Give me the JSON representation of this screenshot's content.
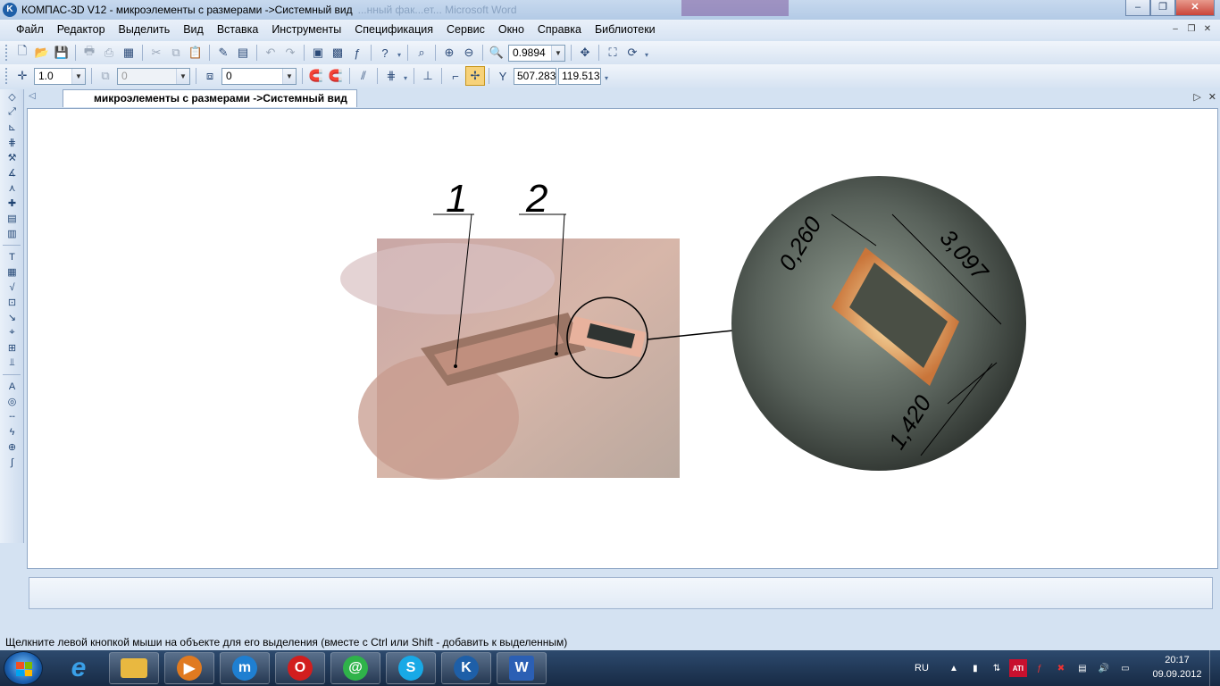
{
  "window": {
    "title": "КОМПАС-3D V12 - микроэлементы с размерами ->Системный вид",
    "ghost_text": "...нный фак...ет... Microsoft Word",
    "minimize_glyph": "–",
    "maximize_glyph": "❐",
    "close_glyph": "✕"
  },
  "menu": {
    "items": [
      "Файл",
      "Редактор",
      "Выделить",
      "Вид",
      "Вставка",
      "Инструменты",
      "Спецификация",
      "Сервис",
      "Окно",
      "Справка",
      "Библиотеки"
    ],
    "mdi_minimize": "–",
    "mdi_restore": "❐",
    "mdi_close": "✕"
  },
  "toolbar_view": {
    "zoom_value": "0.9894"
  },
  "toolbar_current": {
    "step_value": "1.0",
    "layer_value": "0",
    "style_value": "0",
    "x_label": "Y",
    "x_coord": "507.283",
    "y_coord": "119.513"
  },
  "document_tab": {
    "title": "микроэлементы с размерами ->Системный вид"
  },
  "drawing": {
    "callout_1": "1",
    "callout_2": "2",
    "dim_wall": "0,260",
    "dim_width": "3,097",
    "dim_height": "1,420"
  },
  "status": {
    "message": "Щелкните левой кнопкой мыши на объекте для его выделения (вместе с Ctrl или Shift - добавить к выделенным)"
  },
  "taskbar": {
    "apps": [
      {
        "name": "taskbar-explorer",
        "glyph": "",
        "color": "#e9b840"
      },
      {
        "name": "taskbar-media-player",
        "glyph": "▶",
        "color": "#e07a20"
      },
      {
        "name": "taskbar-maxthon",
        "glyph": "m",
        "color": "#1f7fd1"
      },
      {
        "name": "taskbar-opera",
        "glyph": "O",
        "color": "#d21e1e"
      },
      {
        "name": "taskbar-mail-agent",
        "glyph": "@",
        "color": "#2fb34a"
      },
      {
        "name": "taskbar-skype",
        "glyph": "S",
        "color": "#18a9e6"
      },
      {
        "name": "taskbar-kompas",
        "glyph": "K",
        "color": "#1e5fa8"
      },
      {
        "name": "taskbar-word",
        "glyph": "W",
        "color": "#2b5fb4"
      }
    ],
    "ie_glyph": "e",
    "language": "RU",
    "tray_ati": "ATI",
    "time": "20:17",
    "date": "09.09.2012"
  },
  "colors": {
    "accent": "#1e5fa8",
    "taskbar": "#1f3858",
    "callout_line": "#000000"
  }
}
